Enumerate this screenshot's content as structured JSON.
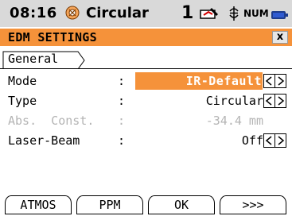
{
  "status": {
    "time": "08:16",
    "mode": "Circular",
    "face": "1",
    "num": "NUM"
  },
  "window": {
    "title": "EDM SETTINGS",
    "close": "x"
  },
  "tab": {
    "label": "General"
  },
  "fields": [
    {
      "label": "Mode",
      "colon": ":",
      "value": "IR-Default",
      "highlighted": true,
      "enabled": true
    },
    {
      "label": "Type",
      "colon": ":",
      "value": "Circular",
      "enabled": true
    },
    {
      "label": "Abs.  Const.",
      "colon": ":",
      "value": "-34.4 mm",
      "enabled": false
    },
    {
      "label": "Laser-Beam",
      "colon": ":",
      "value": "Off",
      "enabled": true
    }
  ],
  "softkeys": [
    "ATMOS",
    "PPM",
    "OK",
    ">>>"
  ],
  "colors": {
    "accent": "#f5923a",
    "statusbar": "#d9d9d9",
    "disabled": "#b4b4b4"
  }
}
